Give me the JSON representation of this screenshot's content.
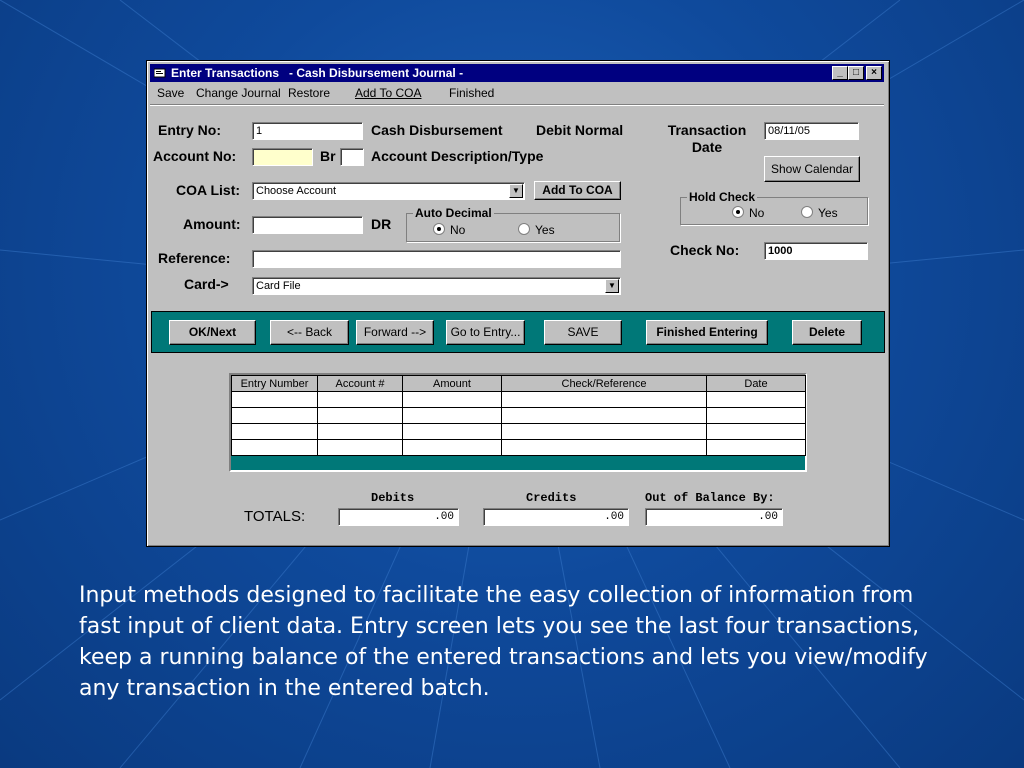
{
  "window": {
    "title": "Enter Transactions   - Cash Disbursement Journal -",
    "controls": {
      "minimize": "_",
      "maximize": "□",
      "close": "×"
    }
  },
  "menu": [
    "Save",
    "Change Journal",
    "Restore",
    "Add To COA",
    "Finished"
  ],
  "form": {
    "entry_no_label": "Entry No:",
    "entry_no_value": "1",
    "journal_type": "Cash Disbursement",
    "normal_label": "Debit Normal",
    "transaction_date_label": "Transaction Date",
    "transaction_date_value": "08/11/05",
    "show_calendar": "Show Calendar",
    "account_no_label": "Account No:",
    "account_no_value": "",
    "br_label": "Br",
    "br_value": "",
    "account_desc_label": "Account Description/Type",
    "coa_list_label": "COA List:",
    "coa_list_value": "Choose Account",
    "add_to_coa": "Add To COA",
    "hold_check_title": "Hold Check",
    "hold_check_no": "No",
    "hold_check_yes": "Yes",
    "amount_label": "Amount:",
    "amount_value": "",
    "dr_label": "DR",
    "auto_decimal_title": "Auto Decimal",
    "auto_decimal_no": "No",
    "auto_decimal_yes": "Yes",
    "check_no_label": "Check No:",
    "check_no_value": "1000",
    "reference_label": "Reference:",
    "reference_value": "",
    "card_label": "Card->",
    "card_value": "Card File"
  },
  "buttons": {
    "ok_next": "OK/Next",
    "back": "<-- Back",
    "forward": "Forward -->",
    "go_to_entry": "Go to Entry...",
    "save": "SAVE",
    "finished_entering": "Finished Entering",
    "delete": "Delete"
  },
  "grid": {
    "columns": [
      "Entry Number",
      "Account #",
      "Amount",
      "Check/Reference",
      "Date"
    ],
    "rows": [
      [
        "",
        "",
        "",
        "",
        ""
      ],
      [
        "",
        "",
        "",
        "",
        ""
      ],
      [
        "",
        "",
        "",
        "",
        ""
      ],
      [
        "",
        "",
        "",
        "",
        ""
      ]
    ]
  },
  "totals": {
    "label": "TOTALS:",
    "debits_label": "Debits",
    "credits_label": "Credits",
    "out_of_balance_label": "Out of Balance By:",
    "debits_value": ".00",
    "credits_value": ".00",
    "out_of_balance_value": ".00"
  },
  "caption": "Input methods designed to facilitate the easy collection of information from fast input of client data.  Entry screen lets you see the last four transactions, keep a running balance of the entered transactions and lets you view/modify any transaction in the entered batch.",
  "colors": {
    "background": "#0f4a9c",
    "titlebar": "#000080",
    "toolbar": "#007878",
    "highlight_field": "#ffffcc"
  }
}
